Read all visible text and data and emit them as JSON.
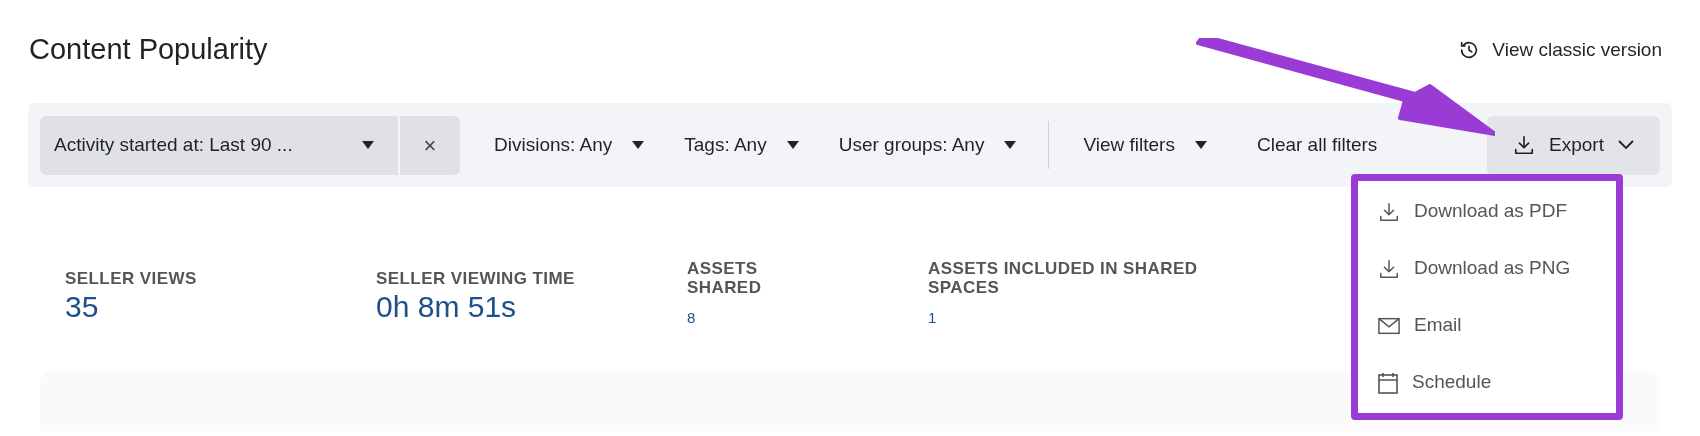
{
  "page": {
    "title": "Content Popularity",
    "classic_link": "View classic version"
  },
  "filters": [
    {
      "kind": "chip",
      "label": "Activity started at: Last 90 ...",
      "clear": "×"
    },
    {
      "kind": "dropdown",
      "label": "Divisions: Any"
    },
    {
      "kind": "dropdown",
      "label": "Tags: Any"
    },
    {
      "kind": "dropdown",
      "label": "User groups: Any"
    },
    {
      "kind": "divider"
    },
    {
      "kind": "dropdown",
      "label": "View filters"
    },
    {
      "kind": "link",
      "label": "Clear all filters"
    }
  ],
  "export": {
    "label": "Export",
    "expanded": true,
    "menu": [
      {
        "kind": "download",
        "label": "Download as PDF"
      },
      {
        "kind": "download",
        "label": "Download as PNG"
      },
      {
        "kind": "email",
        "label": "Email"
      },
      {
        "kind": "schedule",
        "label": "Schedule"
      }
    ]
  },
  "stats": [
    {
      "label": "SELLER VIEWS",
      "value": "35",
      "kind": "large"
    },
    {
      "label": "SELLER VIEWING TIME",
      "value": "0h 8m 51s",
      "kind": "large"
    },
    {
      "label": "ASSETS SHARED",
      "value": "8",
      "kind": "small"
    },
    {
      "label": "ASSETS INCLUDED IN SHARED SPACES",
      "value": "1",
      "kind": "small"
    }
  ]
}
